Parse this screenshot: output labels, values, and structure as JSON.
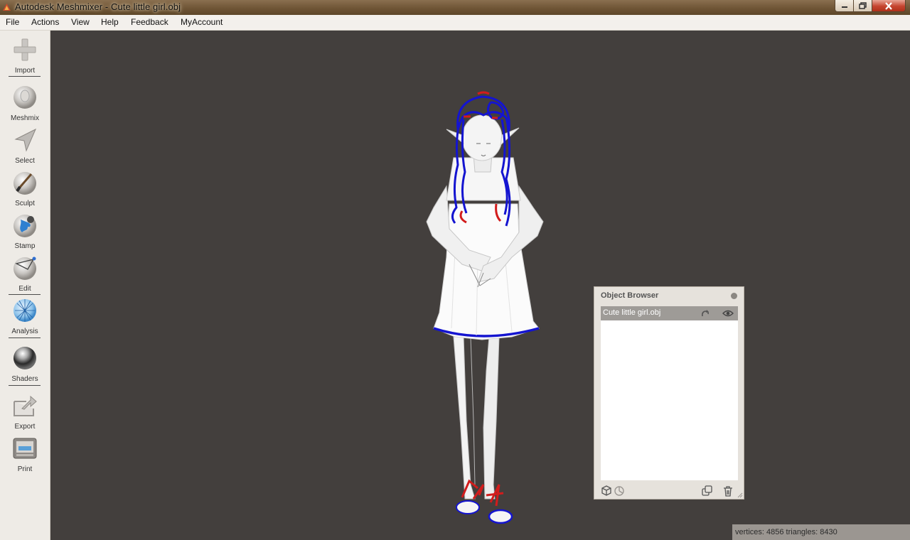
{
  "window": {
    "title": "Autodesk Meshmixer - Cute little girl.obj",
    "colors": {
      "titlebar": "#6f5536",
      "viewport": "#433f3d",
      "panel": "#e6e2dc"
    }
  },
  "menu": {
    "items": [
      {
        "id": "file",
        "label": "File"
      },
      {
        "id": "actions",
        "label": "Actions"
      },
      {
        "id": "view",
        "label": "View"
      },
      {
        "id": "help",
        "label": "Help"
      },
      {
        "id": "feedback",
        "label": "Feedback"
      },
      {
        "id": "myaccount",
        "label": "MyAccount"
      }
    ]
  },
  "toolbar": {
    "tools": [
      {
        "id": "import",
        "label": "Import",
        "icon": "plus-icon"
      },
      {
        "id": "meshmix",
        "label": "Meshmix",
        "icon": "bust-sphere-icon"
      },
      {
        "id": "select",
        "label": "Select",
        "icon": "arrow-pointer-icon"
      },
      {
        "id": "sculpt",
        "label": "Sculpt",
        "icon": "brush-sphere-icon"
      },
      {
        "id": "stamp",
        "label": "Stamp",
        "icon": "stamp-sphere-icon"
      },
      {
        "id": "edit",
        "label": "Edit",
        "icon": "wire-edit-sphere-icon"
      },
      {
        "id": "analysis",
        "label": "Analysis",
        "icon": "mesh-sphere-icon"
      },
      {
        "id": "shaders",
        "label": "Shaders",
        "icon": "chrome-sphere-icon"
      },
      {
        "id": "export",
        "label": "Export",
        "icon": "export-tray-icon"
      },
      {
        "id": "print",
        "label": "Print",
        "icon": "printer-icon"
      }
    ]
  },
  "object_browser": {
    "title": "Object Browser",
    "objects": [
      {
        "name": "Cute little girl.obj",
        "selected": true,
        "visible": true
      }
    ]
  },
  "status": {
    "text": "vertices: 4856 triangles: 8430"
  }
}
